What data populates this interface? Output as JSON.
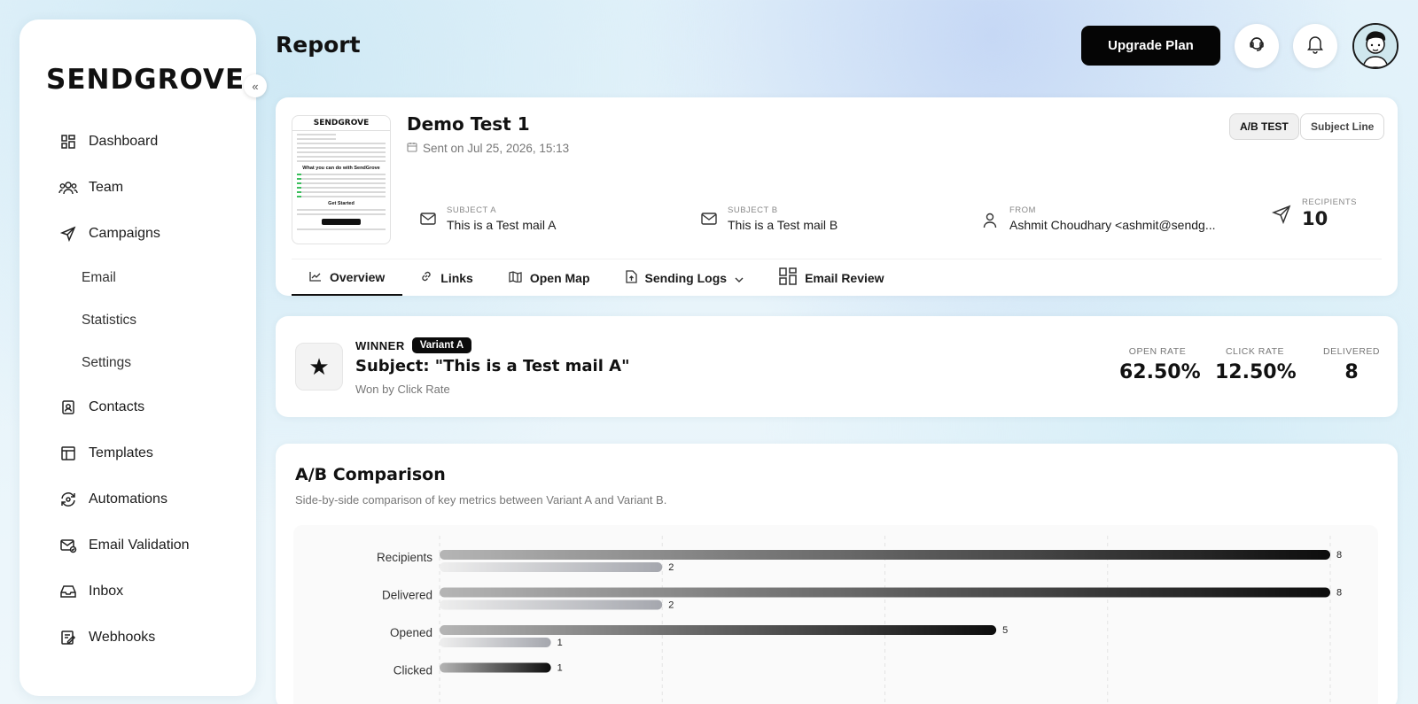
{
  "app": {
    "logo": "SENDGROVE",
    "collapse_icon": "double-chevron-left-icon"
  },
  "sidebar": {
    "items": [
      {
        "label": "Dashboard",
        "icon": "dashboard-icon"
      },
      {
        "label": "Team",
        "icon": "team-icon"
      },
      {
        "label": "Campaigns",
        "icon": "send-icon"
      },
      {
        "label": "Email",
        "sub": true
      },
      {
        "label": "Statistics",
        "sub": true
      },
      {
        "label": "Settings",
        "sub": true
      },
      {
        "label": "Contacts",
        "icon": "contacts-icon"
      },
      {
        "label": "Templates",
        "icon": "templates-icon"
      },
      {
        "label": "Automations",
        "icon": "automation-icon"
      },
      {
        "label": "Email Validation",
        "icon": "mail-check-icon"
      },
      {
        "label": "Inbox",
        "icon": "inbox-icon"
      },
      {
        "label": "Webhooks",
        "icon": "webhook-icon"
      }
    ]
  },
  "header": {
    "title": "Report",
    "upgrade_label": "Upgrade Plan"
  },
  "campaign": {
    "thumb_logo": "SENDGROVE",
    "thumb_heading": "What you can do with SendGrove",
    "thumb_get_started": "Get Started",
    "title": "Demo Test 1",
    "sent_on": "Sent on Jul 25, 2026, 15:13",
    "tag_ab": "A/B TEST",
    "tag_subject": "Subject Line",
    "subject_a_label": "SUBJECT A",
    "subject_a": "This is a Test mail A",
    "subject_b_label": "SUBJECT B",
    "subject_b": "This is a Test mail B",
    "from_label": "FROM",
    "from": "Ashmit Choudhary <ashmit@sendg...",
    "recipients_label": "RECIPIENTS",
    "recipients": "10"
  },
  "tabs": [
    {
      "label": "Overview",
      "icon": "chart-line-icon",
      "active": true
    },
    {
      "label": "Links",
      "icon": "link-icon"
    },
    {
      "label": "Open Map",
      "icon": "map-icon"
    },
    {
      "label": "Sending Logs",
      "icon": "upload-file-icon"
    },
    {
      "label": "Email Review",
      "icon": "grid-icon"
    }
  ],
  "winner": {
    "label": "WINNER",
    "variant": "Variant A",
    "subject": "Subject: \"This is a Test mail A\"",
    "reason": "Won by Click Rate",
    "open_rate_label": "OPEN RATE",
    "open_rate": "62.50%",
    "click_rate_label": "CLICK RATE",
    "click_rate": "12.50%",
    "delivered_label": "DELIVERED",
    "delivered": "8"
  },
  "comparison": {
    "title": "A/B Comparison",
    "subtitle": "Side-by-side comparison of key metrics between Variant A and Variant B."
  },
  "chart_data": {
    "type": "bar",
    "orientation": "horizontal",
    "categories": [
      "Recipients",
      "Delivered",
      "Opened",
      "Clicked"
    ],
    "series": [
      {
        "values": [
          8,
          8,
          5,
          1
        ],
        "color": "#111111"
      },
      {
        "values": [
          2,
          2,
          1,
          null
        ],
        "color": "#a9abb2"
      }
    ],
    "xlim": [
      0,
      8
    ],
    "grid": true
  }
}
